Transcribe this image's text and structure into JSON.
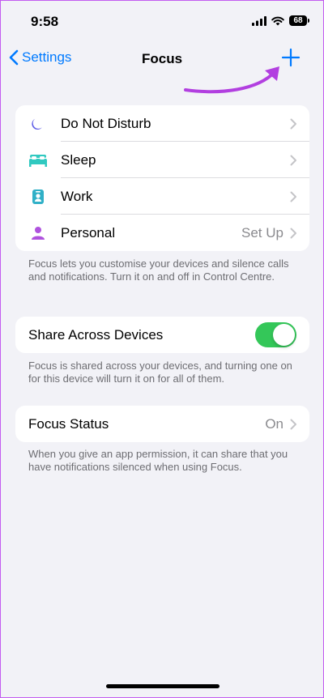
{
  "status_bar": {
    "time": "9:58",
    "battery": "68"
  },
  "nav": {
    "back_label": "Settings",
    "title": "Focus"
  },
  "focus_modes": [
    {
      "label": "Do Not Disturb",
      "icon": "moon-icon",
      "value": "",
      "color": "#5e5ce6"
    },
    {
      "label": "Sleep",
      "icon": "bed-icon",
      "value": "",
      "color": "#30c9c0"
    },
    {
      "label": "Work",
      "icon": "id-badge-icon",
      "value": "",
      "color": "#30b0c7"
    },
    {
      "label": "Personal",
      "icon": "person-icon",
      "value": "Set Up",
      "color": "#af52de"
    }
  ],
  "focus_footer": "Focus lets you customise your devices and silence calls and notifications. Turn it on and off in Control Centre.",
  "share": {
    "label": "Share Across Devices",
    "enabled": true,
    "footer": "Focus is shared across your devices, and turning one on for this device will turn it on for all of them."
  },
  "focus_status": {
    "label": "Focus Status",
    "value": "On",
    "footer": "When you give an app permission, it can share that you have notifications silenced when using Focus."
  },
  "colors": {
    "accent": "#007aff",
    "toggle_on": "#34c759",
    "annotation": "#b23fe0"
  }
}
